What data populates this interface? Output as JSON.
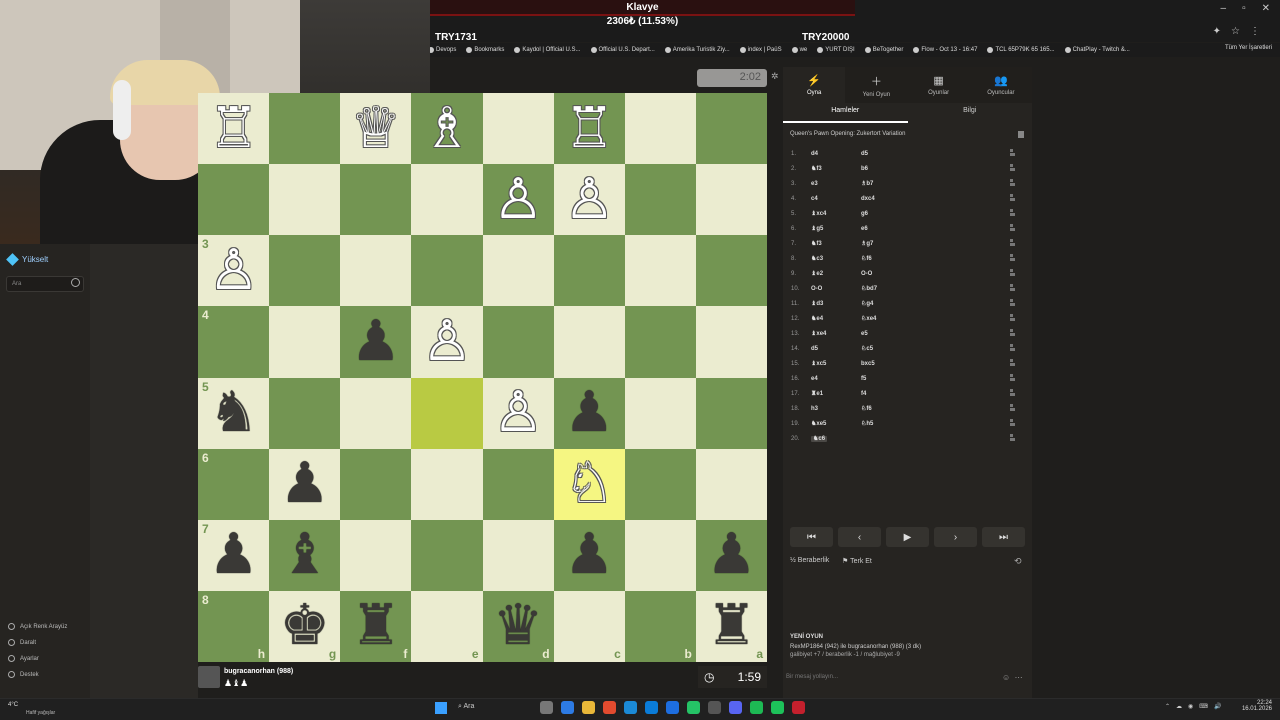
{
  "overlay": {
    "title": "Klavye",
    "subtitle": "2306₺ (11.53%)",
    "left_label": "TRY1731",
    "right_label": "TRY20000"
  },
  "browser": {
    "window_controls": [
      "–",
      "▫",
      "✕"
    ],
    "bookmarks": [
      "Devops",
      "Bookmarks",
      "Kaydol | Official U.S...",
      "Official U.S. Depart...",
      "Amerika Turistik Ziy...",
      "index | PaüS",
      "we",
      "YURT DIŞI",
      "BeTogether",
      "Flow - Oct 13 - 16:47",
      "TCL 65P79K 65 165...",
      "ChatPlay - Twitch &..."
    ],
    "all_bookmarks": "Tüm Yer İşaretleri"
  },
  "sidebar": {
    "upgrade": "Yükselt",
    "search_placeholder": "Ara",
    "bottom_items": [
      "Açık Renk Arayüz",
      "Daralt",
      "Ayarlar",
      "Destek"
    ]
  },
  "board": {
    "timer_top": "2:02",
    "squares": [
      [
        "wR",
        "",
        "wQ",
        "wB",
        "",
        "wR",
        "",
        ""
      ],
      [
        "",
        "",
        "",
        "",
        "wP",
        "wP",
        "",
        ""
      ],
      [
        "wP",
        "",
        "",
        "",
        "",
        "",
        "",
        ""
      ],
      [
        "",
        "",
        "bP",
        "wP",
        "",
        "",
        "",
        ""
      ],
      [
        "bN",
        "",
        "",
        "",
        "wP",
        "bP",
        "",
        ""
      ],
      [
        "",
        "bP",
        "",
        "",
        "",
        "wN",
        "",
        ""
      ],
      [
        "bP",
        "bB",
        "",
        "",
        "",
        "bP",
        "",
        "bP"
      ],
      [
        "",
        "bK",
        "bR",
        "",
        "bQ",
        "",
        "",
        "bR"
      ]
    ],
    "ranks": [
      "3",
      "4",
      "5",
      "6",
      "7",
      "8"
    ],
    "files": [
      "h",
      "g",
      "f",
      "e",
      "d",
      "c",
      "b",
      "a"
    ],
    "highlights": [
      [
        4,
        3
      ],
      [
        5,
        5
      ]
    ]
  },
  "player": {
    "name": "bugracanorhan (988)",
    "captured": "♟♝♟",
    "clock": "1:59"
  },
  "panel": {
    "tabs": [
      {
        "icon": "⚡",
        "label": "Oyna"
      },
      {
        "icon": "＋",
        "label": "Yeni Oyun"
      },
      {
        "icon": "▦",
        "label": "Oyunlar"
      },
      {
        "icon": "👥",
        "label": "Oyuncular"
      }
    ],
    "sub_tabs": [
      "Hamleler",
      "Bilgi"
    ],
    "opening": "Queen's Pawn Opening: Zukertort Variation",
    "moves": [
      {
        "n": "1.",
        "w": "d4",
        "b": "d5"
      },
      {
        "n": "2.",
        "w": "♞f3",
        "b": "b6"
      },
      {
        "n": "3.",
        "w": "e3",
        "b": "♗b7"
      },
      {
        "n": "4.",
        "w": "c4",
        "b": "dxc4"
      },
      {
        "n": "5.",
        "w": "♝xc4",
        "b": "g6"
      },
      {
        "n": "6.",
        "w": "♝g5",
        "b": "e6"
      },
      {
        "n": "7.",
        "w": "♞f3",
        "b": "♗g7"
      },
      {
        "n": "8.",
        "w": "♞c3",
        "b": "♘f6"
      },
      {
        "n": "9.",
        "w": "♝e2",
        "b": "O-O"
      },
      {
        "n": "10.",
        "w": "O-O",
        "b": "♘bd7"
      },
      {
        "n": "11.",
        "w": "♝d3",
        "b": "♘g4"
      },
      {
        "n": "12.",
        "w": "♞e4",
        "b": "♘xe4"
      },
      {
        "n": "13.",
        "w": "♝xe4",
        "b": "e5"
      },
      {
        "n": "14.",
        "w": "d5",
        "b": "♘c5"
      },
      {
        "n": "15.",
        "w": "♝xc5",
        "b": "bxc5"
      },
      {
        "n": "16.",
        "w": "e4",
        "b": "f5"
      },
      {
        "n": "17.",
        "w": "♜e1",
        "b": "f4"
      },
      {
        "n": "18.",
        "w": "h3",
        "b": "♘f6"
      },
      {
        "n": "19.",
        "w": "♞xe5",
        "b": "♘h5"
      },
      {
        "n": "20.",
        "w": "♞c6",
        "b": ""
      }
    ],
    "nav": [
      "⏮",
      "‹",
      "▶",
      "›",
      "⏭"
    ],
    "draw": "½ Beraberlik",
    "resign": "⚑ Terk Et",
    "new_game_title": "YENİ OYUN",
    "new_game_line": "RexMP1864 (942) ile bugracanorhan (988) (3 dk)",
    "new_game_stats": "galibiyet +7 / beraberlik -1 / mağlubiyet -9",
    "chat_placeholder": "Bir mesaj yollayın..."
  },
  "taskbar": {
    "weather": "4°C",
    "weather_sub": "Hafif yağışlar",
    "search": "Ara",
    "time": "22:24",
    "date": "16.01.2026"
  },
  "colors": {
    "light_square": "#ebecd0",
    "dark_square": "#739552",
    "highlight_light": "#f5f682",
    "highlight_dark": "#b9ca43",
    "panel_bg": "#262421"
  }
}
